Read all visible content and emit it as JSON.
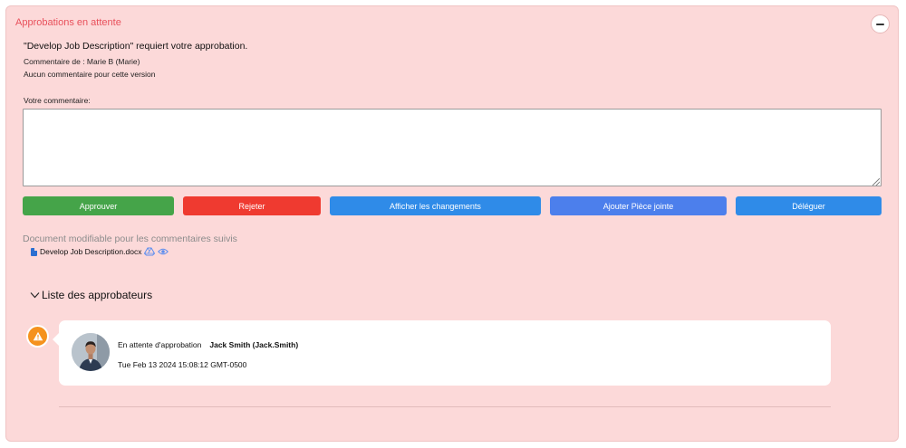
{
  "panel": {
    "title": "Approbations en attente",
    "request_text": "\"Develop Job Description\" requiert votre approbation.",
    "comment_by": "Commentaire de : Marie B (Marie)",
    "no_comment": "Aucun commentaire pour cette version",
    "your_comment_label": "Votre commentaire:",
    "comment_value": ""
  },
  "actions": {
    "approve": "Approuver",
    "reject": "Rejeter",
    "show_changes": "Afficher les changements",
    "add_attachment": "Ajouter Pièce jointe",
    "delegate": "Déléguer"
  },
  "document": {
    "editable_note": "Document modifiable pour les commentaires suivis",
    "file_name": "Develop Job Description.docx"
  },
  "approvers": {
    "header": "Liste des approbateurs",
    "items": [
      {
        "status": "En attente d'approbation",
        "name": "Jack Smith (Jack.Smith)",
        "timestamp": "Tue Feb 13 2024 15:08:12 GMT-0500"
      }
    ]
  },
  "colors": {
    "panel_bg": "#fcd9d9",
    "title": "#e8505b",
    "approve": "#45a449",
    "reject": "#ef3a30",
    "primary": "#2f8be8",
    "attach": "#4c7fec",
    "warning": "#f5921e"
  },
  "icons": {
    "collapse": "minus-circle-icon",
    "doc": "word-doc-icon",
    "drive": "google-drive-icon",
    "preview": "eye-icon",
    "chevron": "chevron-down-icon",
    "warning": "warning-triangle-icon"
  }
}
